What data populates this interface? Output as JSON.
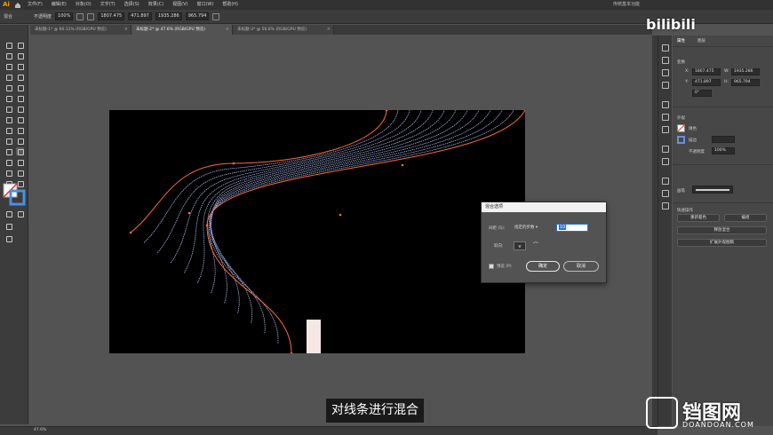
{
  "menubar": {
    "app_logo": "Ai",
    "items": [
      "文件(F)",
      "编辑(E)",
      "对象(O)",
      "文字(T)",
      "选择(S)",
      "效果(C)",
      "视图(V)",
      "窗口(W)",
      "帮助(H)"
    ],
    "workspace": "传统基本功能"
  },
  "controlbar": {
    "mode_label": "混合",
    "opacity_label": "不透明度",
    "opacity_value": "100%",
    "x_value": "1807.475",
    "y_value": "471.897",
    "w_value": "1935.286",
    "h_value": "965.794"
  },
  "tabs": [
    {
      "label": "未标题-1* @ 60.11% (RGB/GPU 预览)"
    },
    {
      "label": "未标题-2* @ 47.6% (RGB/GPU 预览)"
    },
    {
      "label": "未标题-3* @ 56.6% (RGB/GPU 预览)"
    }
  ],
  "dialog": {
    "title": "混合选项",
    "spacing_label": "间距 (S):",
    "spacing_option": "指定的步数",
    "steps_value": "10",
    "orientation_label": "取向:",
    "preview_label": "预览 (P)",
    "ok_label": "确定",
    "cancel_label": "取消"
  },
  "panel": {
    "tab1": "属性",
    "tab2": "图层",
    "section_transform": "变换",
    "x_value": "1807.475",
    "y_value": "471.897",
    "w_value": "1935.286",
    "h_value": "965.794",
    "rotate_value": "0°",
    "section_appearance": "外观",
    "stroke_label": "描边",
    "opacity_label": "不透明度",
    "opacity_value": "100%",
    "brush_label": "画笔",
    "quick_actions": "快速操作",
    "btn_offset": "重新着色",
    "btn_group": "编组",
    "btn_expand": "释放混合",
    "btn_recolor": "扩展外观图稿"
  },
  "status": {
    "zoom": "47.6%"
  },
  "subtitle": "对线条进行混合",
  "watermarks": {
    "bilibili": "bilibili",
    "site": "铛图网",
    "domain": "DOANDOAN.COM"
  },
  "colors": {
    "accent_orange": "#ff6a3a",
    "blend_blue": "#b8c8ff"
  }
}
